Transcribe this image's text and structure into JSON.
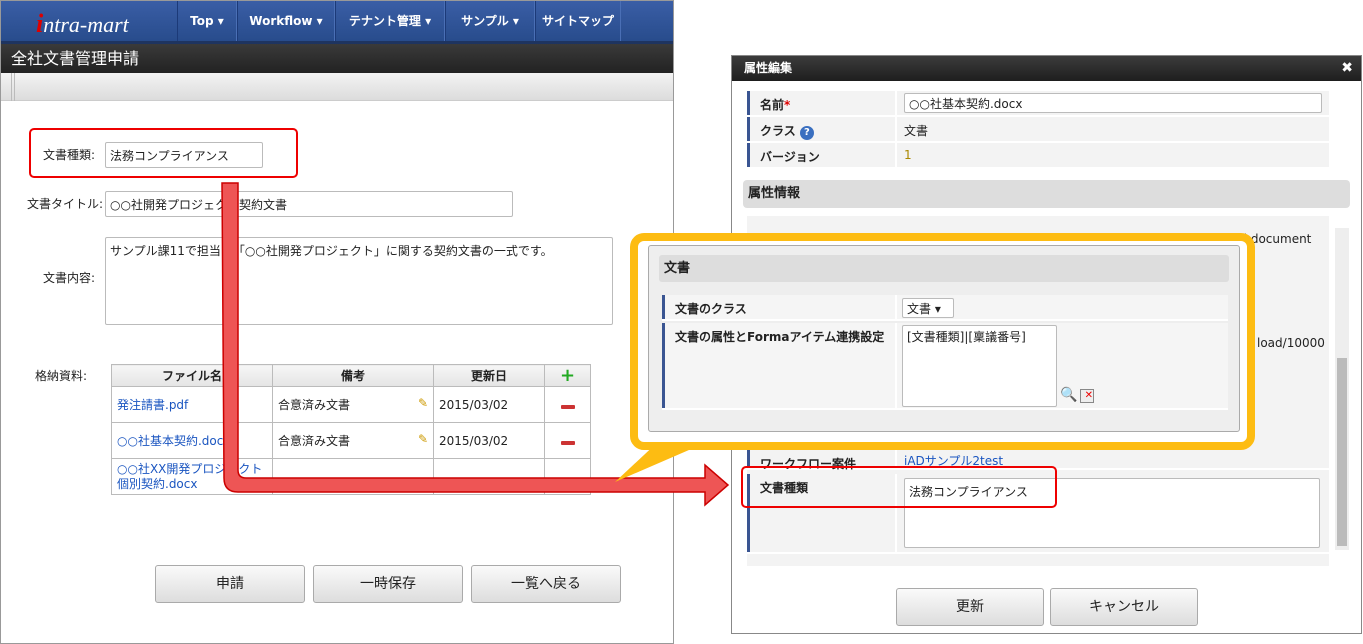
{
  "left": {
    "logo": "intra-mart",
    "nav": [
      "Top ▾",
      "Workflow ▾",
      "テナント管理 ▾",
      "サンプル ▾",
      "サイトマップ"
    ],
    "title": "全社文書管理申請",
    "form": {
      "doc_type_label": "文書種類:",
      "doc_type_value": "法務コンプライアンス",
      "doc_title_label": "文書タイトル:",
      "doc_title_value": "○○社開発プロジェクト契約文書",
      "doc_content_label": "文書内容:",
      "doc_content_value": "サンプル課11で担当中「○○社開発プロジェクト」に関する契約文書の一式です。",
      "attach_label": "格納資料:"
    },
    "table": {
      "headers": [
        "ファイル名",
        "備考",
        "更新日"
      ],
      "rows": [
        {
          "file": "発注請書.pdf",
          "note": "合意済み文書",
          "date": "2015/03/02"
        },
        {
          "file": "○○社基本契約.docx",
          "note": "合意済み文書",
          "date": "2015/03/02"
        },
        {
          "file": "○○社XX開発プロジェクト個別契約.docx",
          "note": "",
          "date": ""
        }
      ]
    },
    "buttons": [
      "申請",
      "一時保存",
      "一覧へ戻る"
    ]
  },
  "dialog": {
    "title": "属性編集",
    "name_label": "名前",
    "required": "*",
    "name_value": "○○社基本契約.docx",
    "class_label": "クラス",
    "class_value": "文書",
    "version_label": "バージョン",
    "version_value": "1",
    "section": "属性情報",
    "partial1": "ml.document",
    "partial2": "load/10000",
    "workflow_label": "ワークフロー案件",
    "workflow_value": "iADサンプル2test",
    "doctype_label": "文書種類",
    "doctype_value": "法務コンプライアンス",
    "buttons": [
      "更新",
      "キャンセル"
    ]
  },
  "callout": {
    "section": "文書",
    "class_label": "文書のクラス",
    "class_select": "文書",
    "mapping_label": "文書の属性とFormaアイテム連携設定",
    "mapping_value": "[文書種類]|[稟議番号]"
  },
  "colors": {
    "highlight_red": "#e00000",
    "callout_yellow": "#fdbc12",
    "nav_blue": "#2f56a0"
  }
}
